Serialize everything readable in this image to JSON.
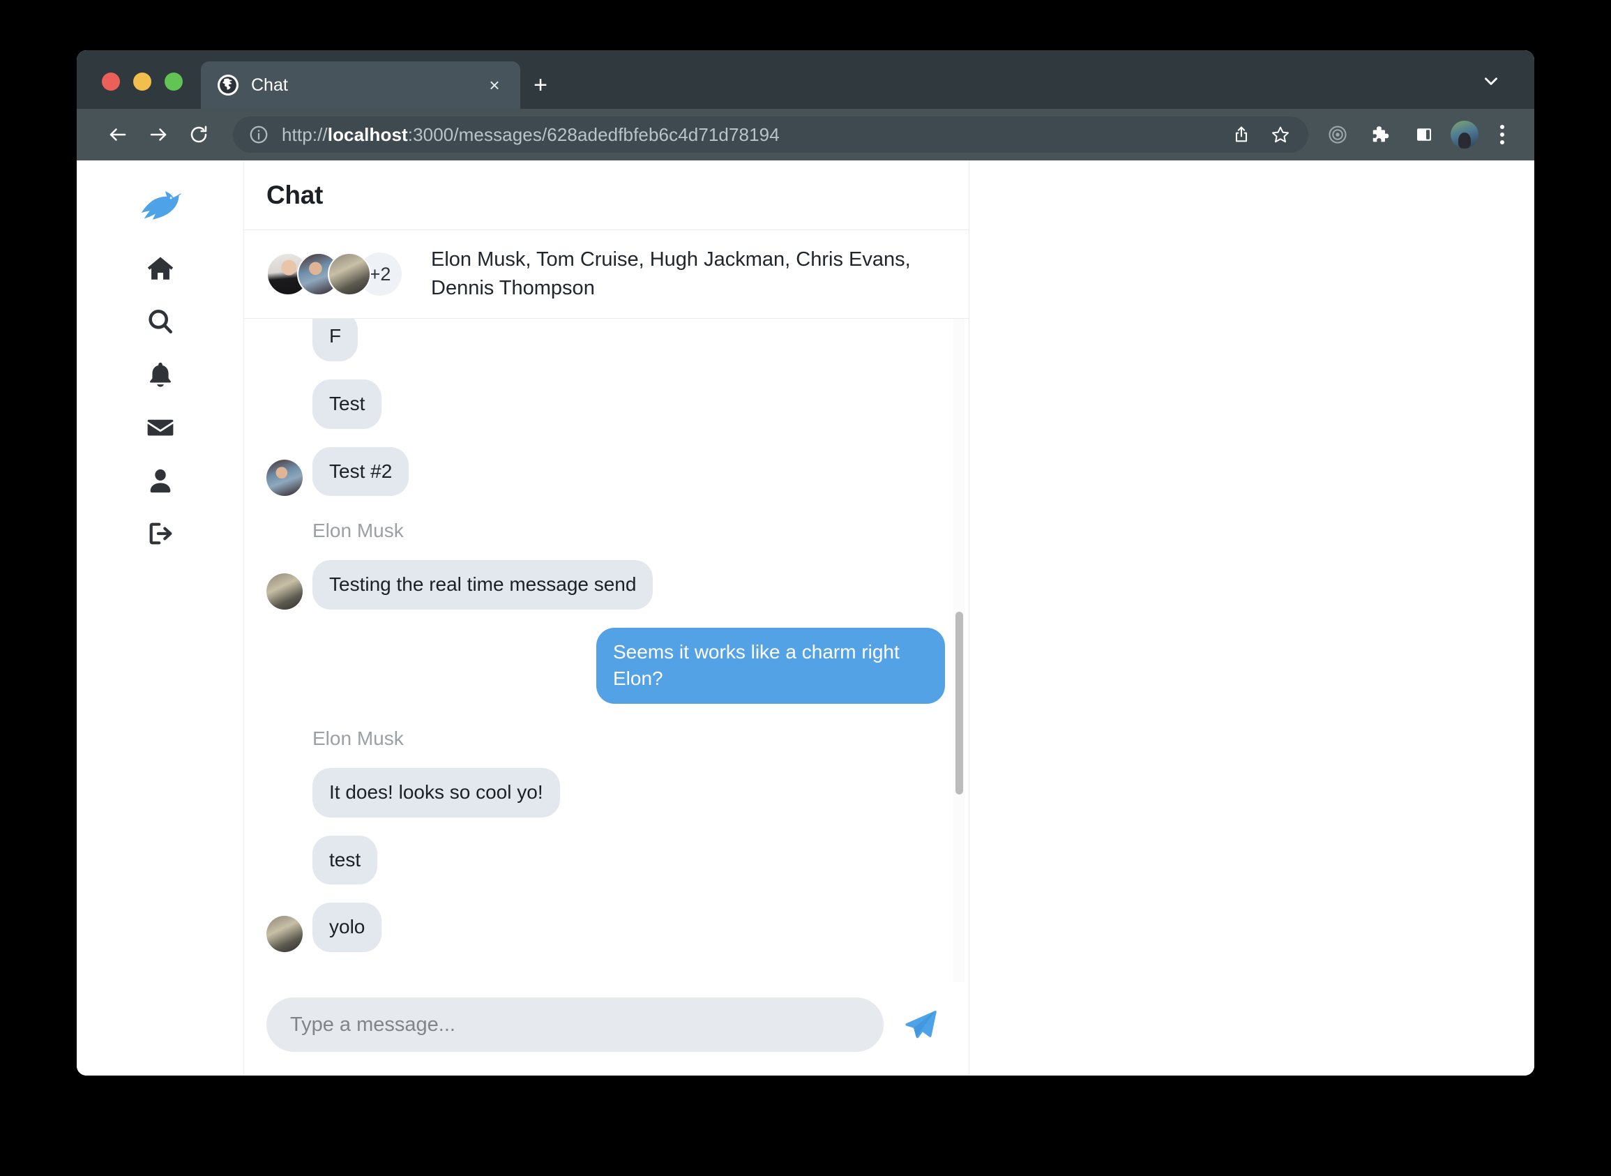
{
  "browser": {
    "tab": {
      "title": "Chat",
      "favicon": "globe-icon",
      "close_label": "×"
    },
    "new_tab_label": "+",
    "url_prefix": "http://",
    "url_host": "localhost",
    "url_rest": ":3000/messages/628adedfbfeb6c4d71d78194",
    "url_full": "http://localhost:3000/messages/628adedfbfeb6c4d71d78194",
    "icons": {
      "back": "back-arrow-icon",
      "forward": "forward-arrow-icon",
      "reload": "reload-icon",
      "info": "site-info-icon",
      "share": "share-icon",
      "bookmark": "bookmark-star-icon",
      "target": "target-icon",
      "extensions": "puzzle-icon",
      "side_panel": "side-panel-icon",
      "profile": "profile-avatar",
      "menu": "three-dot-menu-icon",
      "tab_list": "chevron-down-icon"
    }
  },
  "sidebar": {
    "logo": "bird-logo-icon",
    "items": [
      {
        "name": "home",
        "icon": "home-icon"
      },
      {
        "name": "search",
        "icon": "search-icon"
      },
      {
        "name": "notifications",
        "icon": "bell-icon"
      },
      {
        "name": "messages",
        "icon": "envelope-icon"
      },
      {
        "name": "profile",
        "icon": "person-icon"
      },
      {
        "name": "logout",
        "icon": "logout-icon"
      }
    ]
  },
  "chat": {
    "title": "Chat",
    "participants_text": "Elon Musk, Tom Cruise, Hugh Jackman, Chris Evans, Dennis Thompson",
    "avatar_overflow": "+2",
    "avatars": [
      "hugh-jackman-avatar",
      "tom-cruise-avatar",
      "dennis-thompson-avatar"
    ],
    "messages": [
      {
        "id": 1,
        "text": "F",
        "side": "them",
        "sender": "",
        "avatar": false,
        "clipped": true
      },
      {
        "id": 2,
        "text": "Test",
        "side": "them",
        "sender": "",
        "avatar": false,
        "clipped": false
      },
      {
        "id": 3,
        "text": "Test #2",
        "side": "them",
        "sender": "",
        "avatar": true,
        "clipped": false
      },
      {
        "id": 4,
        "text": "Testing the real time message send",
        "side": "them",
        "sender": "Elon Musk",
        "avatar": true,
        "clipped": false
      },
      {
        "id": 5,
        "text": "Seems it works like a charm right Elon?",
        "side": "me",
        "sender": "",
        "avatar": false,
        "clipped": false
      },
      {
        "id": 6,
        "text": "It does! looks so cool yo!",
        "side": "them",
        "sender": "Elon Musk",
        "avatar": false,
        "clipped": false
      },
      {
        "id": 7,
        "text": "test",
        "side": "them",
        "sender": "",
        "avatar": false,
        "clipped": false
      },
      {
        "id": 8,
        "text": "yolo",
        "side": "them",
        "sender": "",
        "avatar": true,
        "clipped": false
      }
    ]
  },
  "composer": {
    "placeholder": "Type a message...",
    "value": "",
    "send_icon": "send-paper-plane-icon"
  },
  "colors": {
    "accent_blue": "#54a2e6",
    "bubble_gray": "#e3e8ee",
    "chrome_dark": "#2f393e",
    "toolbar": "#485358",
    "logo_blue": "#4da2e8"
  }
}
